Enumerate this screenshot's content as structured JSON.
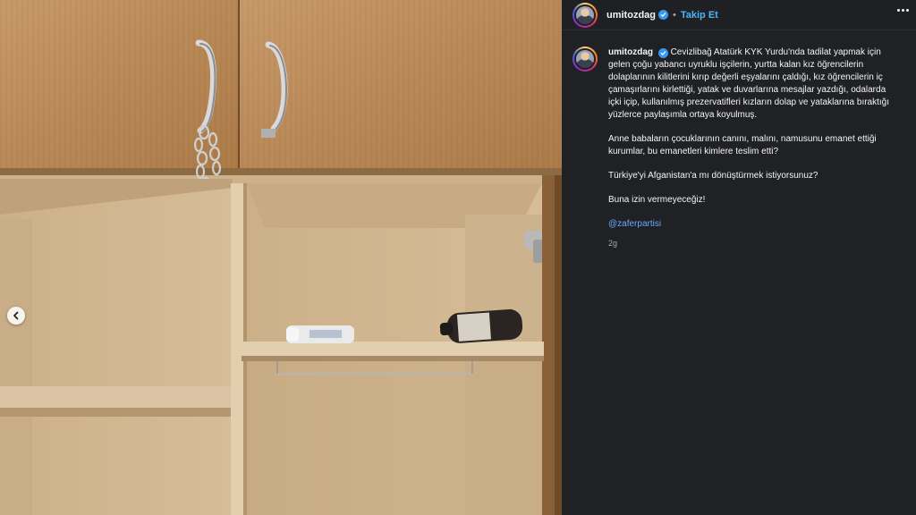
{
  "post": {
    "username": "umitozdag",
    "separator": "•",
    "follow_label": "Takip Et",
    "caption_intro": "Cevizlibağ Atatürk KYK Yurdu'nda tadilat yapmak için gelen çoğu yabancı uyruklu işçilerin, yurtta kalan kız öğrencilerin dolaplarının kilitlerini kırıp değerli eşyalarını çaldığı, kız öğrencilerin iç çamaşırlarını kirlettiği, yatak ve duvarlarına mesajlar yazdığı, odalarda içki içip, kullanılmış prezervatifleri kızların dolap ve yataklarına bıraktığı yüzlerce paylaşımla ortaya koyulmuş.",
    "caption_p2": "Anne babaların çocuklarının canını, malını, namusunu emanet ettiği kurumlar, bu emanetleri kimlere teslim etti?",
    "caption_p3": "Türkiye'yi Afganistan'a mı dönüştürmek istiyorsunuz?",
    "caption_p4": "Buna izin vermeyeceğiz!",
    "mention": "@zaferpartisi",
    "time": "2g"
  },
  "icons": {
    "verified": "verified-badge-icon",
    "more": "more-options-icon",
    "carousel_prev": "chevron-left-icon"
  },
  "colors": {
    "panel_bg": "#202124",
    "link": "#4cb5f9",
    "verified": "#3897f0",
    "muted": "#a8a8a8"
  }
}
